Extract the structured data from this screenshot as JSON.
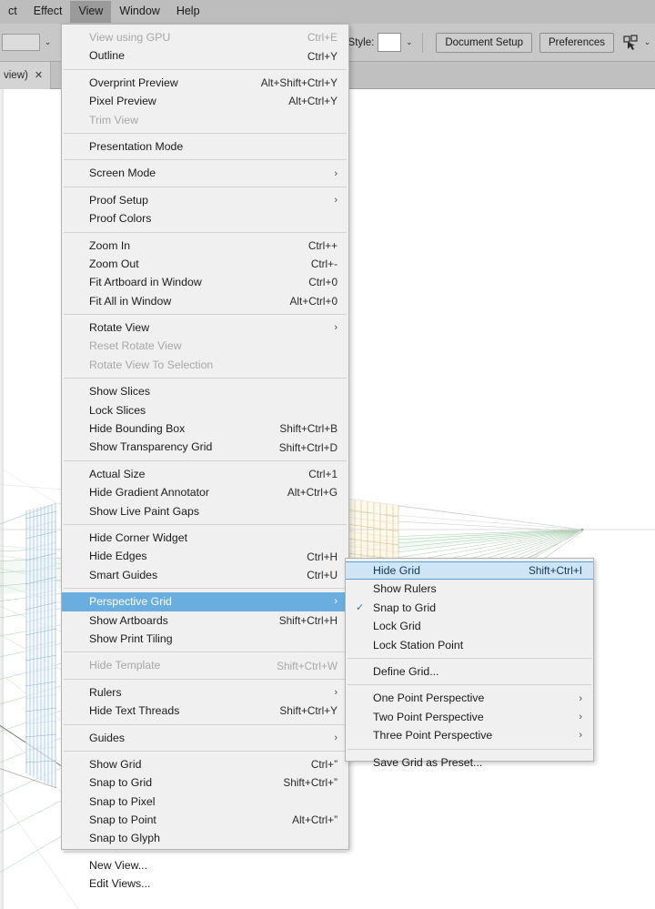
{
  "menubar": {
    "items": [
      {
        "label": "ct",
        "active": false
      },
      {
        "label": "Effect",
        "active": false
      },
      {
        "label": "View",
        "active": true
      },
      {
        "label": "Window",
        "active": false
      },
      {
        "label": "Help",
        "active": false
      }
    ]
  },
  "optionsbar": {
    "stroke_caret": "⌄",
    "style_label": "Style:",
    "document_setup_label": "Document Setup",
    "preferences_label": "Preferences",
    "expand_arrow": "›",
    "right_caret": "⌄"
  },
  "tabstrip": {
    "tab_label": "view)",
    "close_label": "✕"
  },
  "view_menu": {
    "groups": [
      {
        "items": [
          {
            "label": "View using GPU",
            "shortcut": "Ctrl+E",
            "disabled": true,
            "submenu": false,
            "checked": false,
            "highlight": false
          },
          {
            "label": "Outline",
            "shortcut": "Ctrl+Y",
            "disabled": false,
            "submenu": false,
            "checked": false,
            "highlight": false
          }
        ]
      },
      {
        "items": [
          {
            "label": "Overprint Preview",
            "shortcut": "Alt+Shift+Ctrl+Y",
            "disabled": false,
            "submenu": false,
            "checked": false,
            "highlight": false
          },
          {
            "label": "Pixel Preview",
            "shortcut": "Alt+Ctrl+Y",
            "disabled": false,
            "submenu": false,
            "checked": false,
            "highlight": false
          },
          {
            "label": "Trim View",
            "shortcut": "",
            "disabled": true,
            "submenu": false,
            "checked": false,
            "highlight": false
          }
        ]
      },
      {
        "items": [
          {
            "label": "Presentation Mode",
            "shortcut": "",
            "disabled": false,
            "submenu": false,
            "checked": false,
            "highlight": false
          }
        ]
      },
      {
        "items": [
          {
            "label": "Screen Mode",
            "shortcut": "",
            "disabled": false,
            "submenu": true,
            "checked": false,
            "highlight": false
          }
        ]
      },
      {
        "items": [
          {
            "label": "Proof Setup",
            "shortcut": "",
            "disabled": false,
            "submenu": true,
            "checked": false,
            "highlight": false
          },
          {
            "label": "Proof Colors",
            "shortcut": "",
            "disabled": false,
            "submenu": false,
            "checked": false,
            "highlight": false
          }
        ]
      },
      {
        "items": [
          {
            "label": "Zoom In",
            "shortcut": "Ctrl++",
            "disabled": false,
            "submenu": false,
            "checked": false,
            "highlight": false
          },
          {
            "label": "Zoom Out",
            "shortcut": "Ctrl+-",
            "disabled": false,
            "submenu": false,
            "checked": false,
            "highlight": false
          },
          {
            "label": "Fit Artboard in Window",
            "shortcut": "Ctrl+0",
            "disabled": false,
            "submenu": false,
            "checked": false,
            "highlight": false
          },
          {
            "label": "Fit All in Window",
            "shortcut": "Alt+Ctrl+0",
            "disabled": false,
            "submenu": false,
            "checked": false,
            "highlight": false
          }
        ]
      },
      {
        "items": [
          {
            "label": "Rotate View",
            "shortcut": "",
            "disabled": false,
            "submenu": true,
            "checked": false,
            "highlight": false
          },
          {
            "label": "Reset Rotate View",
            "shortcut": "",
            "disabled": true,
            "submenu": false,
            "checked": false,
            "highlight": false
          },
          {
            "label": "Rotate View To Selection",
            "shortcut": "",
            "disabled": true,
            "submenu": false,
            "checked": false,
            "highlight": false
          }
        ]
      },
      {
        "items": [
          {
            "label": "Show Slices",
            "shortcut": "",
            "disabled": false,
            "submenu": false,
            "checked": false,
            "highlight": false
          },
          {
            "label": "Lock Slices",
            "shortcut": "",
            "disabled": false,
            "submenu": false,
            "checked": false,
            "highlight": false
          },
          {
            "label": "Hide Bounding Box",
            "shortcut": "Shift+Ctrl+B",
            "disabled": false,
            "submenu": false,
            "checked": false,
            "highlight": false
          },
          {
            "label": "Show Transparency Grid",
            "shortcut": "Shift+Ctrl+D",
            "disabled": false,
            "submenu": false,
            "checked": false,
            "highlight": false
          }
        ]
      },
      {
        "items": [
          {
            "label": "Actual Size",
            "shortcut": "Ctrl+1",
            "disabled": false,
            "submenu": false,
            "checked": false,
            "highlight": false
          },
          {
            "label": "Hide Gradient Annotator",
            "shortcut": "Alt+Ctrl+G",
            "disabled": false,
            "submenu": false,
            "checked": false,
            "highlight": false
          },
          {
            "label": "Show Live Paint Gaps",
            "shortcut": "",
            "disabled": false,
            "submenu": false,
            "checked": false,
            "highlight": false
          }
        ]
      },
      {
        "items": [
          {
            "label": "Hide Corner Widget",
            "shortcut": "",
            "disabled": false,
            "submenu": false,
            "checked": false,
            "highlight": false
          },
          {
            "label": "Hide Edges",
            "shortcut": "Ctrl+H",
            "disabled": false,
            "submenu": false,
            "checked": false,
            "highlight": false
          },
          {
            "label": "Smart Guides",
            "shortcut": "Ctrl+U",
            "disabled": false,
            "submenu": false,
            "checked": false,
            "highlight": false
          }
        ]
      },
      {
        "items": [
          {
            "label": "Perspective Grid",
            "shortcut": "",
            "disabled": false,
            "submenu": true,
            "checked": false,
            "highlight": true
          },
          {
            "label": "Show Artboards",
            "shortcut": "Shift+Ctrl+H",
            "disabled": false,
            "submenu": false,
            "checked": false,
            "highlight": false
          },
          {
            "label": "Show Print Tiling",
            "shortcut": "",
            "disabled": false,
            "submenu": false,
            "checked": false,
            "highlight": false
          }
        ]
      },
      {
        "items": [
          {
            "label": "Hide Template",
            "shortcut": "Shift+Ctrl+W",
            "disabled": true,
            "submenu": false,
            "checked": false,
            "highlight": false
          }
        ]
      },
      {
        "items": [
          {
            "label": "Rulers",
            "shortcut": "",
            "disabled": false,
            "submenu": true,
            "checked": false,
            "highlight": false
          },
          {
            "label": "Hide Text Threads",
            "shortcut": "Shift+Ctrl+Y",
            "disabled": false,
            "submenu": false,
            "checked": false,
            "highlight": false
          }
        ]
      },
      {
        "items": [
          {
            "label": "Guides",
            "shortcut": "",
            "disabled": false,
            "submenu": true,
            "checked": false,
            "highlight": false
          }
        ]
      },
      {
        "items": [
          {
            "label": "Show Grid",
            "shortcut": "Ctrl+”",
            "disabled": false,
            "submenu": false,
            "checked": false,
            "highlight": false
          },
          {
            "label": "Snap to Grid",
            "shortcut": "Shift+Ctrl+”",
            "disabled": false,
            "submenu": false,
            "checked": false,
            "highlight": false
          },
          {
            "label": "Snap to Pixel",
            "shortcut": "",
            "disabled": false,
            "submenu": false,
            "checked": false,
            "highlight": false
          },
          {
            "label": "Snap to Point",
            "shortcut": "Alt+Ctrl+”",
            "disabled": false,
            "submenu": false,
            "checked": false,
            "highlight": false
          },
          {
            "label": "Snap to Glyph",
            "shortcut": "",
            "disabled": false,
            "submenu": false,
            "checked": false,
            "highlight": false
          }
        ]
      },
      {
        "items": [
          {
            "label": "New View...",
            "shortcut": "",
            "disabled": false,
            "submenu": false,
            "checked": false,
            "highlight": false
          },
          {
            "label": "Edit Views...",
            "shortcut": "",
            "disabled": false,
            "submenu": false,
            "checked": false,
            "highlight": false
          }
        ]
      }
    ]
  },
  "perspective_submenu": {
    "groups": [
      {
        "items": [
          {
            "label": "Hide Grid",
            "shortcut": "Shift+Ctrl+I",
            "disabled": false,
            "submenu": false,
            "checked": false,
            "highlight": true
          },
          {
            "label": "Show Rulers",
            "shortcut": "",
            "disabled": false,
            "submenu": false,
            "checked": false,
            "highlight": false
          },
          {
            "label": "Snap to Grid",
            "shortcut": "",
            "disabled": false,
            "submenu": false,
            "checked": true,
            "highlight": false
          },
          {
            "label": "Lock Grid",
            "shortcut": "",
            "disabled": false,
            "submenu": false,
            "checked": false,
            "highlight": false
          },
          {
            "label": "Lock Station Point",
            "shortcut": "",
            "disabled": false,
            "submenu": false,
            "checked": false,
            "highlight": false
          }
        ]
      },
      {
        "items": [
          {
            "label": "Define Grid...",
            "shortcut": "",
            "disabled": false,
            "submenu": false,
            "checked": false,
            "highlight": false
          }
        ]
      },
      {
        "items": [
          {
            "label": "One Point Perspective",
            "shortcut": "",
            "disabled": false,
            "submenu": true,
            "checked": false,
            "highlight": false
          },
          {
            "label": "Two Point Perspective",
            "shortcut": "",
            "disabled": false,
            "submenu": true,
            "checked": false,
            "highlight": false
          },
          {
            "label": "Three Point Perspective",
            "shortcut": "",
            "disabled": false,
            "submenu": true,
            "checked": false,
            "highlight": false
          }
        ]
      },
      {
        "items": [
          {
            "label": "Save Grid as Preset...",
            "shortcut": "",
            "disabled": false,
            "submenu": false,
            "checked": false,
            "highlight": false
          }
        ]
      }
    ]
  },
  "colors": {
    "menu_bg": "#f0f0f0",
    "menubar_bg": "#bdbdbd",
    "highlight_blue": "#6aaee0",
    "submenu_highlight": "#cfe4f5",
    "grid_left_blue": "#7ea9cf",
    "grid_right_orange": "#d6b878",
    "grid_floor_green": "#8fbf9a",
    "canvas_bg": "#ffffff"
  },
  "glyphs": {
    "submenu_arrow": "›",
    "check": "✓",
    "close": "✕",
    "caret_down": "⌄"
  }
}
